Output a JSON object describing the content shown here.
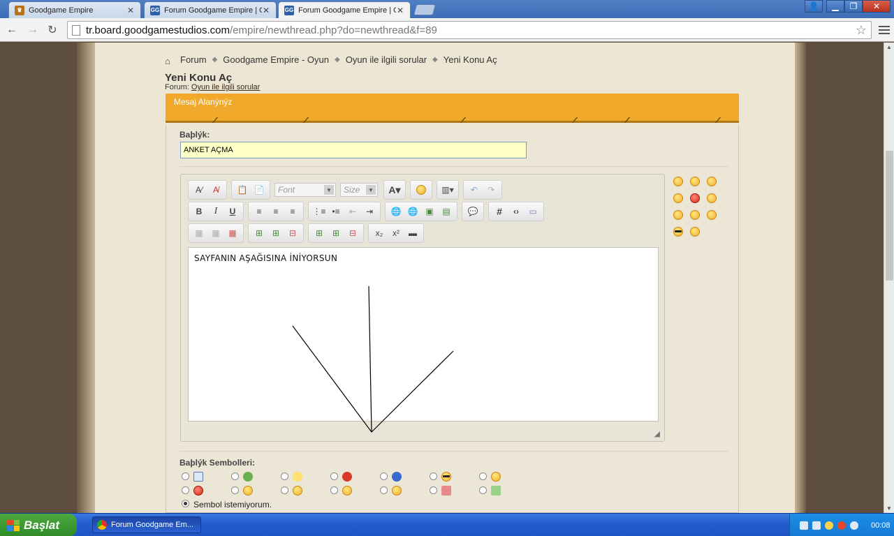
{
  "browser": {
    "tabs": [
      {
        "title": "Goodgame Empire",
        "favicon": "crown-icon",
        "active": false
      },
      {
        "title": "Forum Goodgame Empire | Gc",
        "favicon": "gg-icon",
        "active": false
      },
      {
        "title": "Forum Goodgame Empire | Gc",
        "favicon": "gg-icon",
        "active": true
      }
    ],
    "url_host": "tr.board.goodgamestudios.com",
    "url_path": "/empire/newthread.php?do=newthread&f=89"
  },
  "breadcrumb": [
    "Forum",
    "Goodgame Empire - Oyun",
    "Oyun ile ilgili sorular",
    "Yeni Konu Aç"
  ],
  "page": {
    "title": "Yeni Konu Aç",
    "forum_prefix": "Forum:",
    "forum_link": "Oyun ile ilgili sorular",
    "section_header": "Mesaj Alanýnýz",
    "subject_label": "Baþlýk:",
    "subject_value": "ANKET AÇMA",
    "font_placeholder": "Font",
    "size_placeholder": "Size",
    "message_text": "SAYFANIN AŞAĞISINA İNİYORSUN",
    "icons_label": "Baþlýk Sembolleri:",
    "no_icon_label": "Sembol istemiyorum."
  },
  "taskbar": {
    "start_label": "Başlat",
    "task_label": "Forum Goodgame Em...",
    "clock": "00:08"
  },
  "colors": {
    "accent_orange": "#f0a92a",
    "subject_bg": "#ffffc8",
    "paper_bg": "#ede6d4"
  }
}
